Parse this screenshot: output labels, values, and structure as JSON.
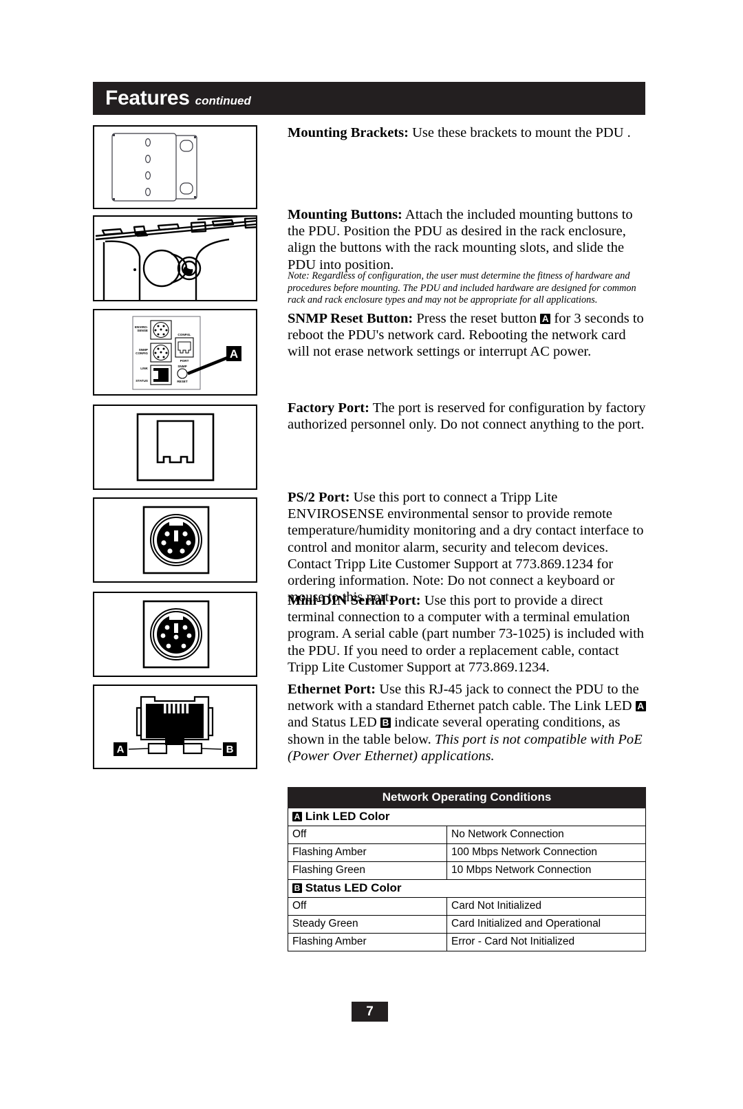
{
  "header": {
    "title": "Features",
    "subtitle": "continued"
  },
  "sections": {
    "mounting_brackets": {
      "label": "Mounting Brackets:",
      "text": " Use these brackets to mount the PDU ."
    },
    "mounting_buttons": {
      "label": "Mounting Buttons:",
      "text": " Attach the included mounting buttons to the PDU. Position the PDU as desired in the rack enclosure, align the buttons with the rack mounting slots, and slide the PDU into position.",
      "note": "Note: Regardless of configuration, the user must determine the fitness of hardware and procedures before mounting. The PDU and included hardware are designed for common rack and rack enclosure types and may not be appropriate for all applications."
    },
    "snmp_reset_button": {
      "label": "SNMP Reset Button:",
      "text_before": " Press the reset button ",
      "badge": "A",
      "text_after": " for 3 seconds to reboot the PDU's network card. Rebooting the network card will not erase network settings or interrupt AC power."
    },
    "factory_port": {
      "label": "Factory Port:",
      "text": " The port is reserved for configuration by factory authorized personnel only. Do not connect anything to the port."
    },
    "ps2_port": {
      "label": "PS/2 Port:",
      "text": " Use this port to connect a Tripp Lite ENVIROSENSE environmental sensor to provide remote temperature/humidity monitoring and a dry contact interface to control and monitor alarm, security and telecom devices. Contact Tripp Lite Customer Support at 773.869.1234 for ordering information. Note: Do not connect a keyboard or mouse to this port."
    },
    "minidin_serial_port": {
      "label": "Mini-DIN Serial Port:",
      "text": " Use this port to provide a direct terminal connection to a computer with a terminal emulation program. A serial cable (part number 73-1025) is included with the PDU. If you need to order a replacement cable, contact Tripp Lite Customer Support at 773.869.1234."
    },
    "ethernet_port": {
      "label": "Ethernet Port:",
      "text_1": " Use this RJ-45 jack to connect the PDU to the network with a standard Ethernet patch cable. The Link LED ",
      "badge_a": "A",
      "text_2": " and Status LED ",
      "badge_b": "B",
      "text_3": " indicate several operating conditions, as shown in the table below. ",
      "text_italic": "This port is not compatible with PoE (Power Over Ethernet) applications."
    }
  },
  "figures": {
    "snmp_panel_labels": {
      "enviro": "ENVIRO SENSE",
      "snmp_config": "SNMP CONFIG",
      "link": "LINK",
      "status": "STATUS",
      "config_port": "CONFIG. PORT",
      "snmp_reset": "SNMP RESET",
      "callout_a": "A"
    },
    "ethernet_callouts": {
      "left": "A",
      "right": "B"
    }
  },
  "table": {
    "title": "Network Operating Conditions",
    "sections": [
      {
        "badge": "A",
        "heading": "Link LED Color",
        "rows": [
          [
            "Off",
            "No Network Connection"
          ],
          [
            "Flashing Amber",
            "100 Mbps Network Connection"
          ],
          [
            "Flashing Green",
            "10 Mbps Network Connection"
          ]
        ]
      },
      {
        "badge": "B",
        "heading": "Status LED Color",
        "rows": [
          [
            "Off",
            "Card Not Initialized"
          ],
          [
            "Steady Green",
            "Card Initialized and Operational"
          ],
          [
            "Flashing Amber",
            "Error - Card Not Initialized"
          ]
        ]
      }
    ]
  },
  "footer": {
    "page_number": "7"
  },
  "colors": {
    "ink": "#231f20",
    "paper": "#ffffff"
  }
}
